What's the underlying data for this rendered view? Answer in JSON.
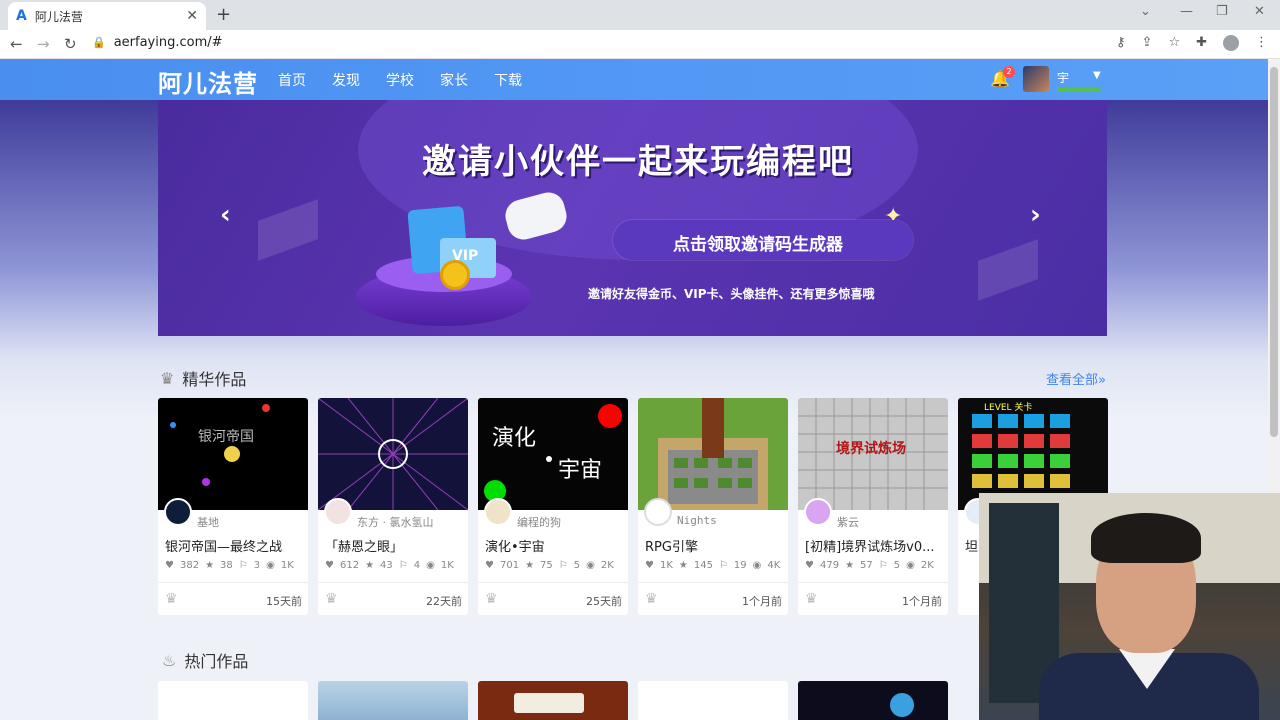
{
  "browser": {
    "tab_title": "阿儿法营",
    "tab_favicon": "A",
    "new_tab": "+",
    "url": "aerfaying.com/#",
    "window_controls": [
      "—",
      "❐",
      "✕"
    ],
    "toolbar_icons": [
      "key-icon",
      "share-icon",
      "star-icon",
      "puzzle-icon",
      "profile-icon",
      "menu-icon"
    ]
  },
  "site": {
    "logo": "阿儿法营",
    "nav": [
      "首页",
      "发现",
      "学校",
      "家长",
      "下载"
    ],
    "notification_count": "2",
    "username": "宇"
  },
  "banner": {
    "headline": "邀请小伙伴一起来玩编程吧",
    "cta": "点击领取邀请码生成器",
    "subtitle": "邀请好友得金币、VIP卡、头像挂件、还有更多惊喜哦",
    "vip_label": "VIP"
  },
  "featured": {
    "title": "精华作品",
    "view_all": "查看全部»",
    "cards": [
      {
        "author": "基地",
        "title": "银河帝国—最终之战",
        "likes": "382",
        "stars": "38",
        "forks": "3",
        "views": "1K",
        "time": "15天前",
        "thumb_text": "银河帝国"
      },
      {
        "author": "东方 · 氯水氢山",
        "title": "「赫恩之眼」",
        "likes": "612",
        "stars": "43",
        "forks": "4",
        "views": "1K",
        "time": "22天前",
        "thumb_text": ""
      },
      {
        "author": "编程的狗",
        "title": "演化•宇宙",
        "likes": "701",
        "stars": "75",
        "forks": "5",
        "views": "2K",
        "time": "25天前",
        "thumb_text": "演化",
        "thumb_text2": "宇宙"
      },
      {
        "author": "Nights",
        "title": "RPG引擎",
        "likes": "1K",
        "stars": "145",
        "forks": "19",
        "views": "4K",
        "time": "1个月前",
        "thumb_text": ""
      },
      {
        "author": "紫云",
        "title": "[初精]境界试炼场v0...",
        "likes": "479",
        "stars": "57",
        "forks": "5",
        "views": "2K",
        "time": "1个月前",
        "thumb_text": "境界试炼场"
      },
      {
        "author": "",
        "title": "坦",
        "likes": "",
        "stars": "",
        "forks": "",
        "views": "",
        "time": "",
        "thumb_text": "LEVEL 关卡"
      }
    ]
  },
  "hot": {
    "title": "热门作品"
  }
}
